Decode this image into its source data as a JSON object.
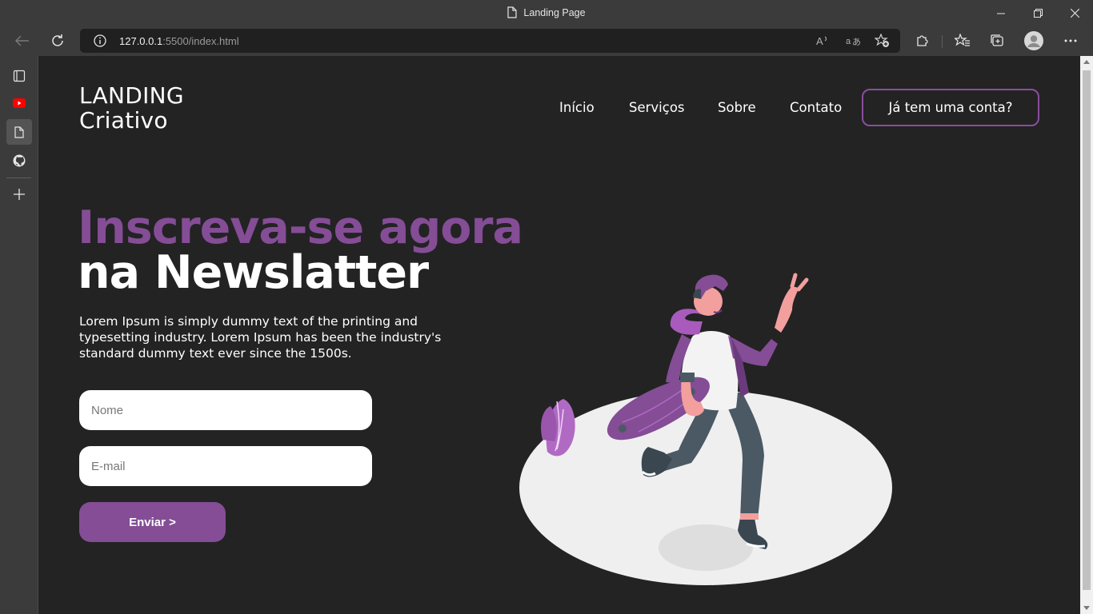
{
  "browser": {
    "window_title": "Landing Page",
    "url_host": "127.0.0.1",
    "url_rest": ":5500/index.html"
  },
  "colors": {
    "accent": "#844d96",
    "page_background": "#232323",
    "chrome": "#3b3b3b"
  },
  "header": {
    "logo_line1": "LANDING",
    "logo_line2": "Criativo",
    "nav": [
      "Início",
      "Serviços",
      "Sobre",
      "Contato"
    ],
    "login_button": "Já tem uma conta?"
  },
  "hero": {
    "title_line1": "Inscreva-se agora",
    "title_line2": "na Newslatter",
    "description": "Lorem Ipsum is simply dummy text of the printing and typesetting industry. Lorem Ipsum has been the industry's standard dummy text ever since the 1500s.",
    "form": {
      "name_placeholder": "Nome",
      "email_placeholder": "E-mail",
      "submit_label": "Enviar >"
    }
  }
}
